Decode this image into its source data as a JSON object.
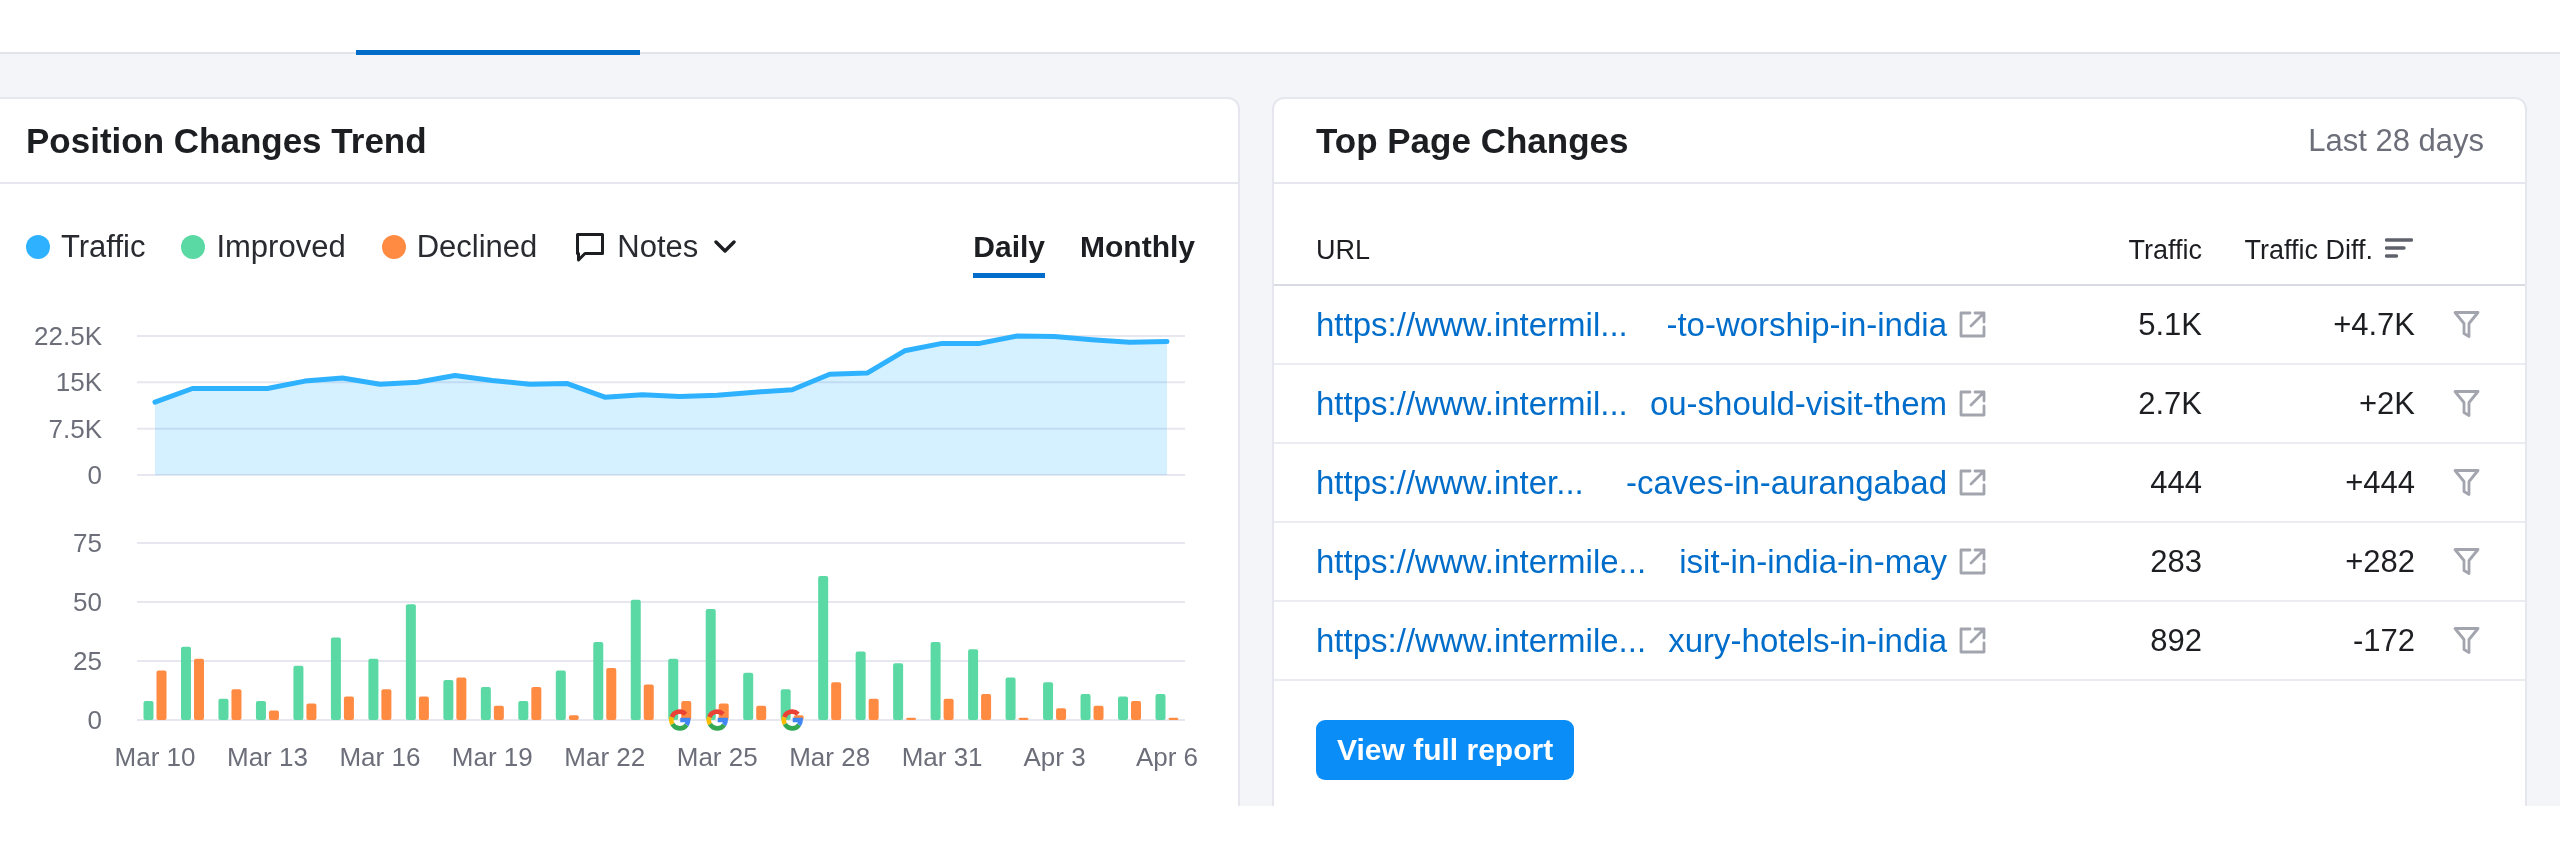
{
  "position_changes": {
    "title": "Position Changes Trend",
    "notes": {
      "label": "Notes"
    },
    "periods": [
      {
        "label": "Daily",
        "selected": true
      },
      {
        "label": "Monthly",
        "selected": false
      }
    ],
    "traffic_chart": {
      "chart_data": {
        "type": "area",
        "series": [
          {
            "name": "Traffic",
            "color": "#2eb2ff",
            "values": [
              11800,
              14000,
              14000,
              14000,
              15200,
              15700,
              14700,
              15000,
              16100,
              15300,
              14700,
              14800,
              12600,
              13000,
              12700,
              12900,
              13400,
              13800,
              16300,
              16500,
              20100,
              21300,
              21300,
              22500,
              22400,
              21900,
              21500,
              21600
            ]
          }
        ],
        "ylim": [
          0,
          22500
        ],
        "yticks": [
          0,
          {
            "value": 7500,
            "label": "7.5K"
          },
          {
            "value": 15000,
            "label": "15K"
          },
          {
            "value": 22500,
            "label": "22.5K"
          }
        ]
      }
    },
    "changes_chart": {
      "chart_data": {
        "type": "bar",
        "categories": [
          "Mar 10",
          null,
          null,
          "Mar 13",
          null,
          null,
          "Mar 16",
          null,
          null,
          "Mar 19",
          null,
          null,
          "Mar 22",
          null,
          null,
          "Mar 25",
          null,
          null,
          "Mar 28",
          null,
          null,
          "Mar 31",
          null,
          null,
          "Apr 3",
          null,
          null,
          "Apr 6"
        ],
        "series": [
          {
            "name": "Improved",
            "color": "#5ad9a4",
            "values": [
              8,
              31,
              9,
              8,
              23,
              35,
              26,
              49,
              17,
              14,
              8,
              21,
              33,
              51,
              26,
              47,
              20,
              13,
              61,
              29,
              24,
              33,
              30,
              18,
              16,
              11,
              10,
              11
            ]
          },
          {
            "name": "Declined",
            "color": "#ff8a42",
            "values": [
              21,
              26,
              13,
              4,
              7,
              10,
              13,
              10,
              18,
              6,
              14,
              2,
              22,
              15,
              8,
              7,
              6,
              2,
              16,
              9,
              1,
              9,
              11,
              1,
              5,
              6,
              8,
              1
            ]
          }
        ],
        "ylim": [
          0,
          75
        ],
        "yticks": [
          0,
          25,
          50,
          75
        ]
      },
      "day_markers": [
        false,
        false,
        false,
        false,
        false,
        false,
        false,
        false,
        false,
        false,
        false,
        false,
        false,
        false,
        true,
        true,
        false,
        true,
        false,
        false,
        false,
        false,
        false,
        false,
        false,
        false,
        false,
        false
      ]
    }
  },
  "top_page_changes": {
    "title": "Top Page Changes",
    "period": "Last 28 days",
    "columns": [
      {
        "label": "URL",
        "sorted": false
      },
      {
        "label": "Traffic",
        "sorted": false
      },
      {
        "label": "Traffic Diff.",
        "sorted": true
      }
    ],
    "rows": [
      {
        "url": "https://www.intermil... -to-worship-in-india",
        "traffic": "5.1K",
        "traffic_diff": "+4.7K"
      },
      {
        "url": "https://www.intermil... ou-should-visit-them",
        "traffic": "2.7K",
        "traffic_diff": "+2K"
      },
      {
        "url": "https://www.inter... -caves-in-aurangabad",
        "traffic": "444",
        "traffic_diff": "+444"
      },
      {
        "url": "https://www.intermile... isit-in-india-in-may",
        "traffic": "283",
        "traffic_diff": "+282"
      },
      {
        "url": "https://www.intermile... xury-hotels-in-india",
        "traffic": "892",
        "traffic_diff": "-172"
      }
    ],
    "button": "View full report"
  }
}
